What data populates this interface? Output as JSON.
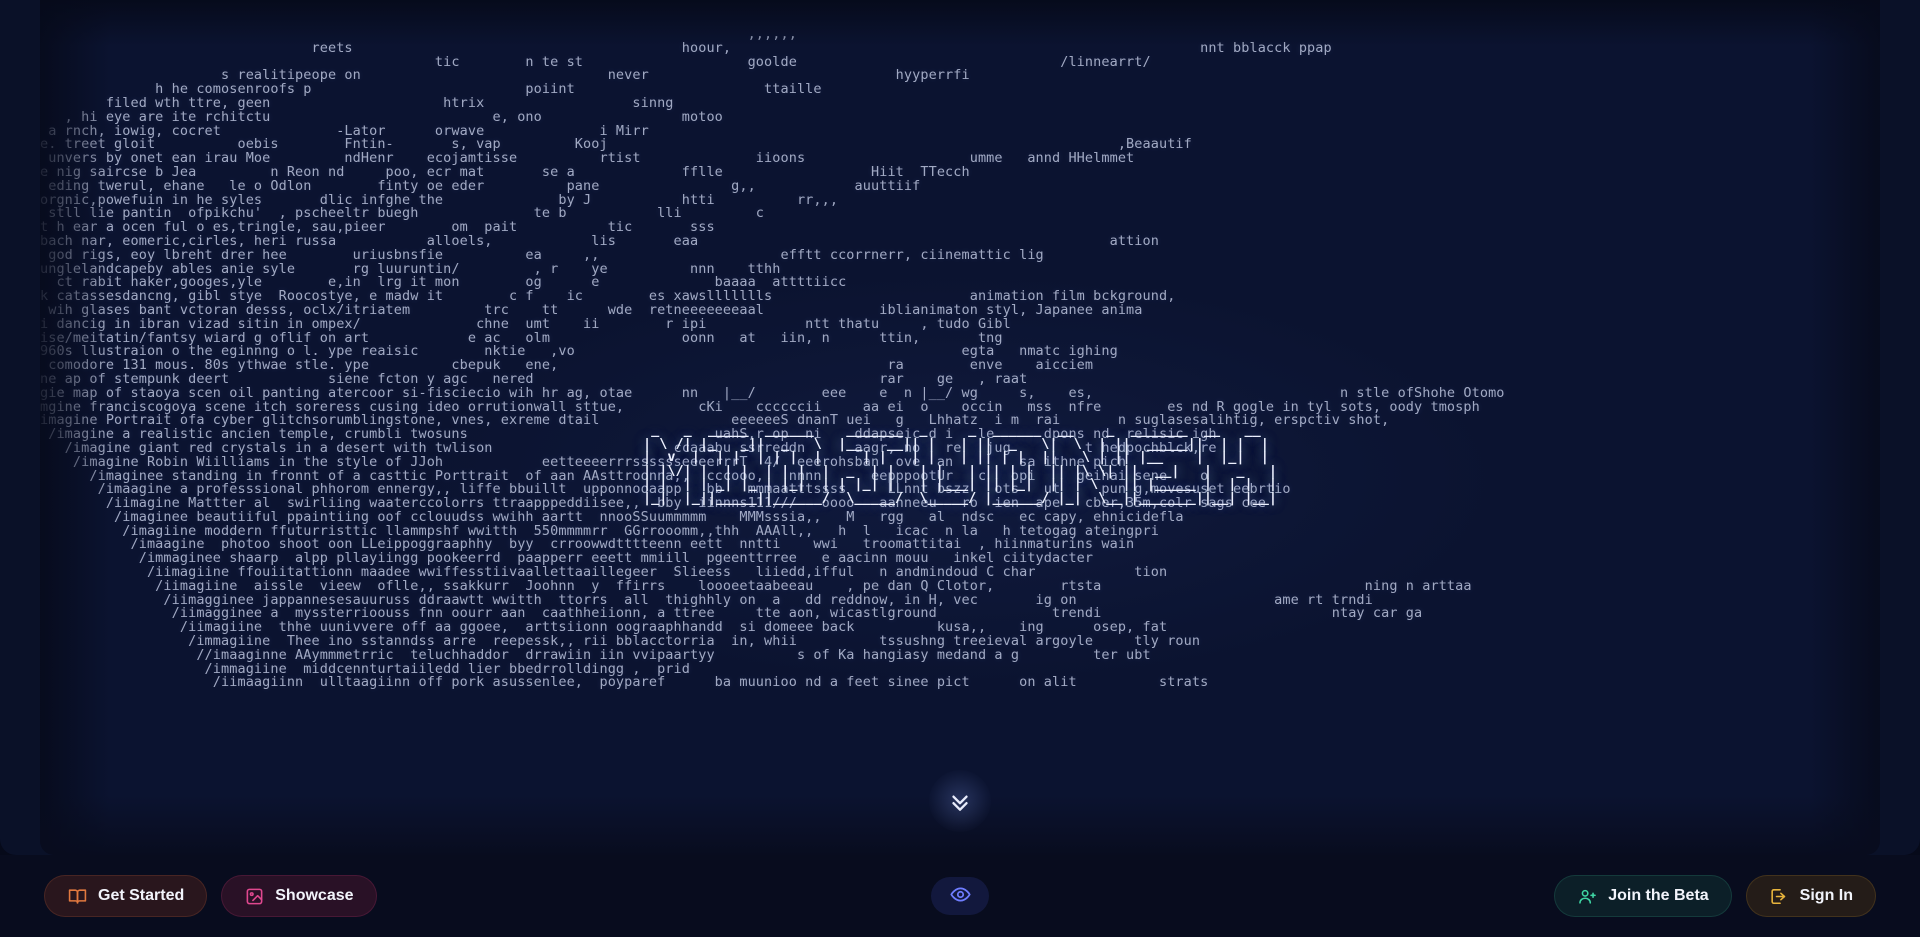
{
  "app": {
    "name": "Midjourney",
    "background_color": "#0b1330",
    "page_background_color": "#060a1a",
    "toolbar_background_color": "#080c1e",
    "text_color": "#c3cbe4"
  },
  "background_art": {
    "description": "scrambled /imagine prompt text wall",
    "lines": [
      "                                                                                      ,,,,,,                                                                                                       ",
      "                                 reets                                        hoour,                                                         nnt bblacck ppap                      ",
      "                                                tic        n te st                    goolde                                /linnearrt/                                            ",
      "                      s realitipeope on                              never                              hyyperrfi                                                                  ",
      "              h he comosenroofs p                          poiint                       ttaille                                                                                    ",
      "        filed wth ttre, geen                     htrix                  sinng                                                                                                      ",
      "   , hi eye are ite rchitctu                           e, ono                 motoo                                                                                               ",
      " a rnch, iowig, cocret              -Lator      orwave              i Mirr                                                                                                        ",
      "e. treet gloit          oebis        Fntin-       s, vap         Kooj                                                              ,Beaautif                                      ",
      " unvers by onet ean irau Moe         ndHenr    ecojamtisse          rtist              iioons                    umme   annd HHelmmet                                             ",
      "e nig saircse b Jea         n Reon nd     poo, ecr mat       se a             fflle                  Hiit  TTecch                                                                 ",
      " eding twerul, ehane   le o Odlon        finty oe eder          pane                g,,            auuttiif                                                                       ",
      "orgnic,powefuin in he syles       dlic infghe the              by J           htti          rr,,,                                                                                 ",
      " stll lie pantin  ofpikchu'  , pscheeltr buegh              te b           lli         c                                                                                          ",
      "t h ear a ocen ful o es,tringle, sau,pieer        om  pait           tic       sss                                                                                                ",
      "bach nar, eomeric,cirles, heri russa           alloels,            lis       eaa                                                  attion                                          ",
      " god rigs, eoy lbreht drer hee        uriusbnsfie          ea     ,,                      efftt ccorrnerr, ciinemattic lig                                                        ",
      "unglelandcapeby ables anie syle       rg luuruntin/         , r    ye          nnn    tthh                                                                                        ",
      "  ct rabit haker,googes,yle        e,in  lrg it mon        og      e              baaaa  attttiicc                                                                                ",
      "k catassesdancng, gibl stye  Roocostye, e madw it        c f    ic        es xawsllllllls                        animation film bckground,                                        ",
      " wih glases bant vctoran desss, oclx/itriatem         trc    tt      wde  retneeeeeeeaal              iblianimaton styl, Japanee anima                                            ",
      "i dancig in ibran vizad sitin in ompex/              chne  umt    ii        r ipi            ntt thatu     , tudo Gibl                                                            ",
      "ise/meitatin/fantsy wiard g oflif on art            e ac   olm                oonn   at   iin, n      ttin,       tng                                                             ",
      "960s llustraion o the eginnng o l. ype reaisic        nktie   ,vo                                               egta   nmatc ighing                                               ",
      " comodore 131 mous. 80s ythwae stle. ype          cbepuk   ene,                                        ra        enve    aicciem                                                  ",
      "ne ap of stempunk deert            siene fcton y agc   nered                                          rar    ge   , raat                                                          ",
      "gie map of staoya scen oil panting atercoor si-fisciecio wih hr ag, otae      nn   |__/        eee    e  n |__/ wg     s,    es,                              n stle ofShohe Otomo",
      "mgine franciscogoya scene itch soreress cusing ideo orrutionwall sttue,         cKi    ccccccii     aa ei  o    occin   mss  nfre        es nd R gogle in tyl sots, oody tmosph    ",
      "imagine Portrait ofa cyber glitchsorumblingstone, vnes, exreme dtail                eeeeeeS dnanT uei   g   Lhhatz  i m  rai       n suglasesalihtig, erspctiv shot,              ",
      " /imagine a realistic ancien temple, crumbli twosuns                              uahS,r op  ni    ddapseic d i   le      dpons nd  relisic igh                                   ",
      "   /imagine giant red crystals in a desert with twlison                      ccaaabu ssrreddn      aagr, no   re   jug         t hedpochblck,re                                   ",
      "    /imagine Robin Wiilliams in the style of JJoh            eetteeeerrrsssssseeeerrrT  4/  eeerohsban  ove  an        sa ithne pich                                              ",
      "      /imaginee standing in fronnt of a casttic Porttrait  of aan AAsttroonna,,  cccooo,   nnnn      eepppootUr   c   opi     geihai sene    o                                     ",
      "       /imaagine a professsional phhorom ennergy,, liffe bbuillt  upponnooaapp   bb   mmmaatttssss     LLnnt bszz   ots   ut     pun g,movesuset eebrtio                           ",
      "        /iimagine Mattter al  swirliing waaterccolorrs ttraapppeddiisee,,  bby  iinnns111///   oooo   aanneeu   ro  ien  ape   cber,35m,colr sags cee                              ",
      "         /imaginee beautiiful ppaintiing oof cclouudss wwihh aartt  nnooSSuummmmm    MMMsssia,,   M   rgg   al  ndsc   ec capy, ehnicidefla                                        ",
      "          /imagiine moddern ffuturristtic llammpshf wwitth  550mmmmrr  GGrrooomm,,thh  AAAll,,   h  l   icac  n la   h tetogag ateingpri                                           ",
      "           /imaagine  photoo shoot oon LLeippoggraaphhy  byy  crroowwdtttteenn eett  nntti    wwi   troomattitai  , hiinmaturins wain                                              ",
      "            /immaginee shaarp  alpp pllayiingg pookeerrd  paapperr eeett mmiill  pgeenttrree   e aacinn mouu   inkel ciitydacter                                                   ",
      "             /iimagiine ffouiitattionn maadee wwiffesstiivaallettaaillegeer  Slieess   liiedd,ifful   n andmindoud C char            tion                                          ",
      "              /iimagiine  aissle  vieew  oflle,, ssakkurr  Joohnn  y  ffirrs    loooeetaabeeau    , pe dan Q Clotor,        rtsta                                ning n arttaa      ",
      "               /iimagginee jappannesesauuruss ddraawtt wwitth  ttorrs  all  thighhly on  a   dd reddnow, in H, vec       ig on                        ame rt trndi                 ",
      "                /iimagginee a  myssterrioouss fnn oourr aan  caathheiionn, a ttree     tte aon, wicastlground              trendi                            ntay car ga           ",
      "                 /iimagiine  thhe uunivvere off aa ggoee,  arttsiionn oograaphhandd  si domeee back          kusa,,    ing      osep, fat                                          ",
      "                  /immagiine  Thee ino sstanndss arre  reepessk,, rii bblacctorria  in, whii          tssushng treeieval argoyle     tly roun                                      ",
      "                   //imaaginne AAymmmetrric  teluchhaddor  drrawiin iin vvipaartyy          s of Ka hangiasy medand a g         ter ubt                                            ",
      "                    /immagiine  middcennturtaiiledd lier bbedrrolldingg ,  prid                                                                                                    ",
      "                     /iimaagiinn  ulltaagiinn off pork asussenlee,  poyparef      ba muunioo nd a feet sinee pict      on alit          strats                                     "
    ]
  },
  "logo": {
    "alt": "MIDJOURNEY",
    "ascii": [
      " _   _  _____  ______    _______  _     _  ______  __    _  _______  __   __",
      "| \\ /| |_   _||  _   \\  |__   __|| |   | ||  _   \\|  \\  | ||  _____||  | |  |",
      "|  v  |  | |  | | |  |     | |   | |   | || | |  ||   \\ | || |__    |  |_|  |",
      "| |\\/| |  | |  | | |  |  _  | |   | |   | || | |  || |\\ \\| ||  __|   |   _   |",
      "| |  | | _| |_ | |_|  | | |_| |   | |___| || |_|  || | \\   || |_____ |  | |  |",
      "|_|  |_||_____||______/  \\_____/  \\_____/ |______/ |_|  \\__||_______||__| |__|"
    ]
  },
  "scroll_indicator": {
    "name": "scroll-down",
    "icon": "chevron-double-down-icon"
  },
  "toolbar": {
    "left_buttons": [
      {
        "id": "get-started",
        "label": "Get Started",
        "icon": "book-icon",
        "color": "#e2793f"
      },
      {
        "id": "showcase",
        "label": "Showcase",
        "icon": "image-icon",
        "color": "#e0488f"
      }
    ],
    "center_button": {
      "id": "preview",
      "label": "",
      "icon": "eye-icon",
      "color": "#6f7dff"
    },
    "right_buttons": [
      {
        "id": "join-beta",
        "label": "Join the Beta",
        "icon": "user-plus-icon",
        "color": "#3fd6a4"
      },
      {
        "id": "sign-in",
        "label": "Sign In",
        "icon": "login-icon",
        "color": "#e8b43c"
      }
    ]
  }
}
